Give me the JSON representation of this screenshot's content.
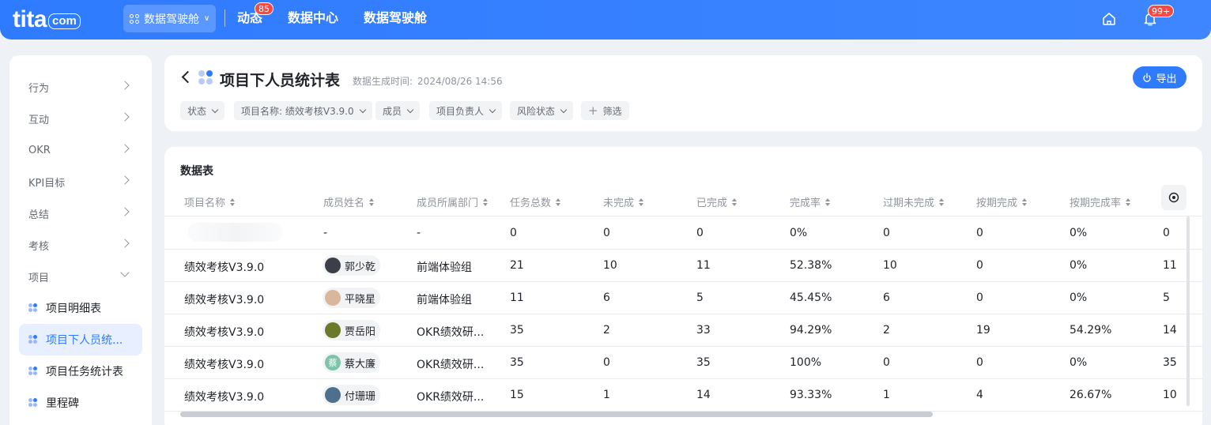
{
  "topbar": {
    "logo": {
      "word": "tita",
      "suffix": "com"
    },
    "workspace": {
      "label": "数据驾驶舱"
    },
    "nav": [
      {
        "label": "动态",
        "badge": "85"
      },
      {
        "label": "数据中心"
      },
      {
        "label": "数据驾驶舱"
      }
    ],
    "notifications_badge": "99+",
    "colors": {
      "primary": "#2f7bff",
      "badge": "#f54a45"
    },
    "icons": [
      "home-icon",
      "bell-icon"
    ]
  },
  "sidebar": {
    "items": [
      {
        "label": "行为",
        "expanded": false
      },
      {
        "label": "互动",
        "expanded": false
      },
      {
        "label": "OKR",
        "expanded": false
      },
      {
        "label": "KPI目标",
        "expanded": false
      },
      {
        "label": "总结",
        "expanded": false
      },
      {
        "label": "考核",
        "expanded": false
      },
      {
        "label": "项目",
        "expanded": true
      }
    ],
    "sub_items": [
      {
        "label": "项目明细表",
        "active": false
      },
      {
        "label": "项目下人员统...",
        "active": true
      },
      {
        "label": "项目任务统计表",
        "active": false
      },
      {
        "label": "里程碑",
        "active": false
      }
    ]
  },
  "header": {
    "title": "项目下人员统计表",
    "generated_label": "数据生成时间:",
    "generated_time": "2024/08/26 14:56",
    "export_label": "导出",
    "filters": [
      {
        "label": "状态"
      },
      {
        "label": "项目名称: 绩效考核V3.9.0"
      },
      {
        "label": "成员"
      },
      {
        "label": "项目负责人"
      },
      {
        "label": "风险状态"
      }
    ],
    "add_filter_label": "筛选"
  },
  "table": {
    "title": "数据表",
    "columns": [
      "项目名称",
      "成员姓名",
      "成员所属部门",
      "任务总数",
      "未完成",
      "已完成",
      "完成率",
      "过期未完成",
      "按期完成",
      "按期完成率",
      ""
    ],
    "rows": [
      {
        "project": "",
        "member": "-",
        "avatar": "",
        "dept": "-",
        "total": "0",
        "incomplete": "0",
        "completed": "0",
        "rate": "0%",
        "overdue": "0",
        "ontime": "0",
        "ontime_rate": "0%",
        "extra": "0"
      },
      {
        "project": "绩效考核V3.9.0",
        "member": "郭少乾",
        "avatar": "#3a3f4a",
        "dept": "前端体验组",
        "total": "21",
        "incomplete": "10",
        "completed": "11",
        "rate": "52.38%",
        "overdue": "10",
        "ontime": "0",
        "ontime_rate": "0%",
        "extra": "11"
      },
      {
        "project": "绩效考核V3.9.0",
        "member": "平晓星",
        "avatar": "#d9b79a",
        "dept": "前端体验组",
        "total": "11",
        "incomplete": "6",
        "completed": "5",
        "rate": "45.45%",
        "overdue": "6",
        "ontime": "0",
        "ontime_rate": "0%",
        "extra": "5"
      },
      {
        "project": "绩效考核V3.9.0",
        "member": "贾岳阳",
        "avatar": "#6a7a2a",
        "dept": "OKR绩效研...",
        "total": "35",
        "incomplete": "2",
        "completed": "33",
        "rate": "94.29%",
        "overdue": "2",
        "ontime": "19",
        "ontime_rate": "54.29%",
        "extra": "14"
      },
      {
        "project": "绩效考核V3.9.0",
        "member": "蔡大廉",
        "avatar": "#7ec4a8",
        "avatar_text": "蔡",
        "dept": "OKR绩效研...",
        "total": "35",
        "incomplete": "0",
        "completed": "35",
        "rate": "100%",
        "overdue": "0",
        "ontime": "0",
        "ontime_rate": "0%",
        "extra": "35"
      },
      {
        "project": "绩效考核V3.9.0",
        "member": "付珊珊",
        "avatar": "#4f6f8f",
        "dept": "OKR绩效研...",
        "total": "15",
        "incomplete": "1",
        "completed": "14",
        "rate": "93.33%",
        "overdue": "1",
        "ontime": "4",
        "ontime_rate": "26.67%",
        "extra": "10"
      }
    ]
  }
}
